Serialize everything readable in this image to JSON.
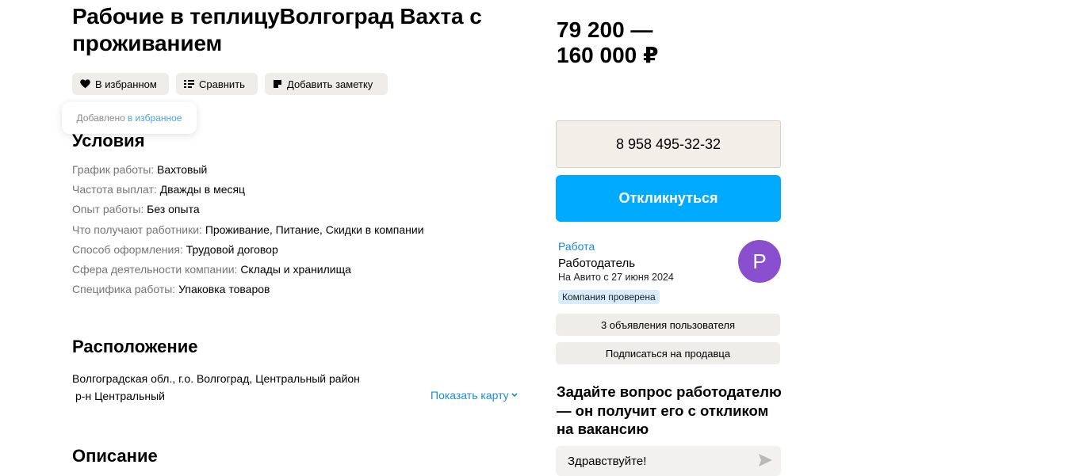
{
  "vacancy": {
    "title": "Рабочие в теплицуВолгоград Вахта с проживанием"
  },
  "actions": {
    "favorite_label": "В избранном",
    "compare_label": "Сравнить",
    "note_label": "Добавить заметку"
  },
  "toast": {
    "text": "Добавлено",
    "link": "в избранное"
  },
  "conditions": {
    "heading": "Условия",
    "rows": [
      {
        "key": "График работы:",
        "value": "Вахтовый"
      },
      {
        "key": "Частота выплат:",
        "value": "Дважды в месяц"
      },
      {
        "key": "Опыт работы:",
        "value": "Без опыта"
      },
      {
        "key": "Что получают работники:",
        "value": "Проживание, Питание, Скидки в компании"
      },
      {
        "key": "Способ оформления:",
        "value": "Трудовой договор"
      },
      {
        "key": "Сфера деятельности компании:",
        "value": "Склады и хранилища"
      },
      {
        "key": "Специфика работы:",
        "value": "Упаковка товаров"
      }
    ]
  },
  "location": {
    "heading": "Расположение",
    "address_line1": "Волгоградская обл., г.о. Волгоград, Центральный район",
    "address_line2": "р-н Центральный",
    "map_link": "Показать карту"
  },
  "description": {
    "heading": "Описание"
  },
  "price": {
    "line1": "79 200 —",
    "line2": "160 000 ₽"
  },
  "contact": {
    "phone": "8 958 495-32-32",
    "respond_label": "Откликнуться"
  },
  "seller": {
    "name": "Работа",
    "role": "Работодатель",
    "since": "На Авито с 27 июня 2024",
    "badge": "Компания проверена",
    "avatar_letter": "Р",
    "listings_label": "3 объявления пользователя",
    "subscribe_label": "Подписаться на продавца"
  },
  "question": {
    "title": "Задайте вопрос работодателю — он получит его с откликом на вакансию",
    "message_value": "Здравствуйте!"
  },
  "colors": {
    "accent_blue": "#00aaff",
    "link_blue": "#1b8bd6",
    "avatar_purple": "#8a4fcf",
    "pill_gray": "#efedea"
  }
}
